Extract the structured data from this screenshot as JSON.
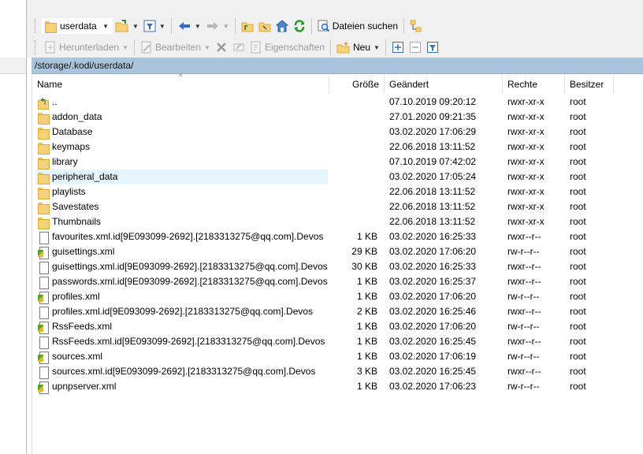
{
  "toolbar1": {
    "directory": "userdata",
    "find_label": "Dateien suchen"
  },
  "toolbar2": {
    "download_label": "Herunterladen",
    "edit_label": "Bearbeiten",
    "properties_label": "Eigenschaften",
    "new_label": "Neu"
  },
  "path": "/storage/.kodi/userdata/",
  "columns": {
    "name": "Name",
    "size": "Größe",
    "modified": "Geändert",
    "permissions": "Rechte",
    "owner": "Besitzer"
  },
  "files": [
    {
      "name": "..",
      "type": "up",
      "size": "",
      "modified": "07.10.2019 09:20:12",
      "permissions": "rwxr-xr-x",
      "owner": "root"
    },
    {
      "name": "addon_data",
      "type": "folder",
      "size": "",
      "modified": "27.01.2020 09:21:35",
      "permissions": "rwxr-xr-x",
      "owner": "root"
    },
    {
      "name": "Database",
      "type": "folder",
      "size": "",
      "modified": "03.02.2020 17:06:29",
      "permissions": "rwxr-xr-x",
      "owner": "root"
    },
    {
      "name": "keymaps",
      "type": "folder",
      "size": "",
      "modified": "22.06.2018 13:11:52",
      "permissions": "rwxr-xr-x",
      "owner": "root"
    },
    {
      "name": "library",
      "type": "folder",
      "size": "",
      "modified": "07.10.2019 07:42:02",
      "permissions": "rwxr-xr-x",
      "owner": "root"
    },
    {
      "name": "peripheral_data",
      "type": "folder",
      "size": "",
      "modified": "03.02.2020 17:05:24",
      "permissions": "rwxr-xr-x",
      "owner": "root"
    },
    {
      "name": "playlists",
      "type": "folder",
      "size": "",
      "modified": "22.06.2018 13:11:52",
      "permissions": "rwxr-xr-x",
      "owner": "root"
    },
    {
      "name": "Savestates",
      "type": "folder",
      "size": "",
      "modified": "22.06.2018 13:11:52",
      "permissions": "rwxr-xr-x",
      "owner": "root"
    },
    {
      "name": "Thumbnails",
      "type": "folder",
      "size": "",
      "modified": "22.06.2018 13:11:52",
      "permissions": "rwxr-xr-x",
      "owner": "root"
    },
    {
      "name": "favourites.xml.id[9E093099-2692].[2183313275@qq.com].Devos",
      "type": "file",
      "size": "1 KB",
      "modified": "03.02.2020 16:25:33",
      "permissions": "rwxr--r--",
      "owner": "root"
    },
    {
      "name": "guisettings.xml",
      "type": "xml",
      "size": "29 KB",
      "modified": "03.02.2020 17:06:20",
      "permissions": "rw-r--r--",
      "owner": "root"
    },
    {
      "name": "guisettings.xml.id[9E093099-2692].[2183313275@qq.com].Devos",
      "type": "file",
      "size": "30 KB",
      "modified": "03.02.2020 16:25:33",
      "permissions": "rwxr--r--",
      "owner": "root"
    },
    {
      "name": "passwords.xml.id[9E093099-2692].[2183313275@qq.com].Devos",
      "type": "file",
      "size": "1 KB",
      "modified": "03.02.2020 16:25:37",
      "permissions": "rwxr--r--",
      "owner": "root"
    },
    {
      "name": "profiles.xml",
      "type": "xml",
      "size": "1 KB",
      "modified": "03.02.2020 17:06:20",
      "permissions": "rw-r--r--",
      "owner": "root"
    },
    {
      "name": "profiles.xml.id[9E093099-2692].[2183313275@qq.com].Devos",
      "type": "file",
      "size": "2 KB",
      "modified": "03.02.2020 16:25:46",
      "permissions": "rwxr--r--",
      "owner": "root"
    },
    {
      "name": "RssFeeds.xml",
      "type": "xml",
      "size": "1 KB",
      "modified": "03.02.2020 17:06:20",
      "permissions": "rw-r--r--",
      "owner": "root"
    },
    {
      "name": "RssFeeds.xml.id[9E093099-2692].[2183313275@qq.com].Devos",
      "type": "file",
      "size": "1 KB",
      "modified": "03.02.2020 16:25:45",
      "permissions": "rwxr--r--",
      "owner": "root"
    },
    {
      "name": "sources.xml",
      "type": "xml",
      "size": "1 KB",
      "modified": "03.02.2020 17:06:19",
      "permissions": "rw-r--r--",
      "owner": "root"
    },
    {
      "name": "sources.xml.id[9E093099-2692].[2183313275@qq.com].Devos",
      "type": "file",
      "size": "3 KB",
      "modified": "03.02.2020 16:25:45",
      "permissions": "rwxr--r--",
      "owner": "root"
    },
    {
      "name": "upnpserver.xml",
      "type": "xml",
      "size": "1 KB",
      "modified": "03.02.2020 17:06:23",
      "permissions": "rw-r--r--",
      "owner": "root"
    }
  ],
  "hovered_file": "peripheral_data",
  "colors": {
    "path_bar": "#a9c3da",
    "row_hover": "#e5f3fb",
    "folder": "#f5d277"
  }
}
